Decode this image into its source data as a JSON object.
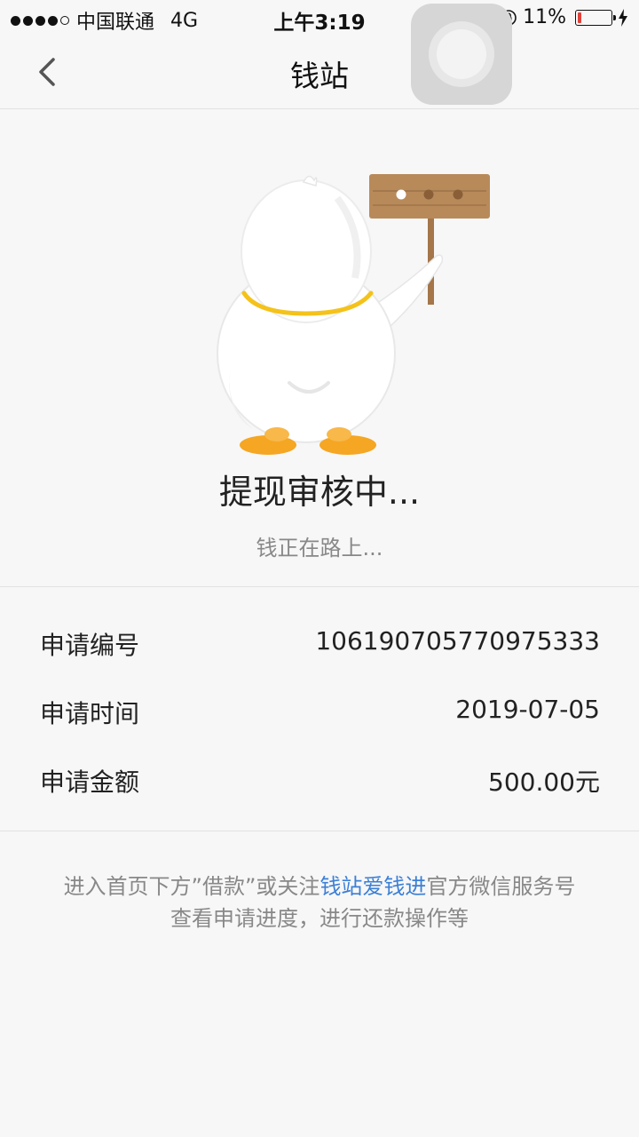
{
  "status_bar": {
    "carrier": "中国联通",
    "network": "4G",
    "time": "上午3:19",
    "battery": "11%",
    "battery_level": 0.11,
    "battery_color": "#e0413a"
  },
  "nav": {
    "title": "钱站",
    "back_icon": "chevron-left-icon"
  },
  "status": {
    "title": "提现审核中...",
    "subtitle": "钱正在路上..."
  },
  "details": [
    {
      "label": "申请编号",
      "value": "106190705770975333"
    },
    {
      "label": "申请时间",
      "value": "2019-07-05"
    },
    {
      "label": "申请金额",
      "value": "500.00元"
    }
  ],
  "footer": {
    "line1_before": "进入首页下方”借款”或关注",
    "line1_link": "钱站爱钱进",
    "line1_after": "官方微信服务号",
    "line2": "查看申请进度，进行还款操作等"
  },
  "colors": {
    "link": "#3b7fd6",
    "background": "#f7f7f7"
  }
}
